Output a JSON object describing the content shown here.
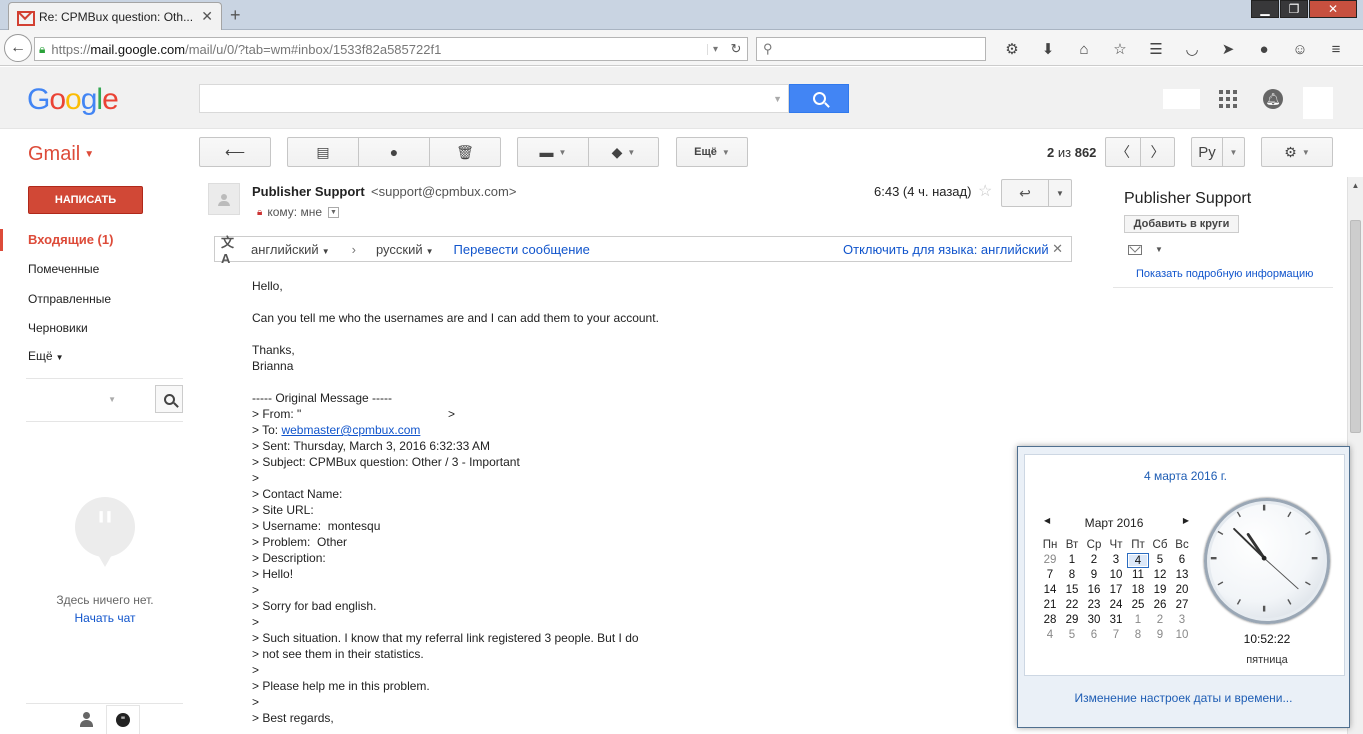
{
  "browser": {
    "tab_title": "Re: CPMBux question: Oth...",
    "tab_close": "✕",
    "new_tab": "+",
    "url_prefix": "https://",
    "url_domain": "mail.google.com",
    "url_path": "/mail/u/0/?tab=wm#inbox/1533f82a585722f1"
  },
  "gmail": {
    "label": "Gmail",
    "pager_range": "2",
    "pager_of": "из",
    "pager_total": "862",
    "more_label": "Ещё",
    "lang_btn": "Ру"
  },
  "nav": {
    "compose": "НАПИСАТЬ",
    "inbox": "Входящие (1)",
    "starred": "Помеченные",
    "sent": "Отправленные",
    "drafts": "Черновики",
    "more": "Ещё"
  },
  "hangouts": {
    "empty": "Здесь ничего нет.",
    "start_chat": "Начать чат"
  },
  "message": {
    "sender_name": "Publisher Support",
    "sender_email": "<support@cpmbux.com>",
    "to_line": "кому: мне",
    "time": "6:43 (4 ч. назад)"
  },
  "translate": {
    "from_lang": "английский",
    "to_lang": "русский",
    "translate_link": "Перевести сообщение",
    "disable_link": "Отключить для языка: английский"
  },
  "body": {
    "greeting": "Hello,",
    "question": "Can you tell me who the usernames are and I can add them to your account.",
    "thanks": "Thanks,",
    "signature": "Brianna",
    "orig_header": "----- Original Message -----",
    "from": "> From: \"                                            >",
    "to_prefix": "> To: ",
    "to_email": "webmaster@cpmbux.com",
    "sent": "> Sent: Thursday, March 3, 2016 6:32:33 AM",
    "subject": "> Subject: CPMBux question: Other / 3 - Important",
    "q1": ">",
    "contact": "> Contact Name:",
    "site": "> Site URL:",
    "username": "> Username:  montesqu",
    "problem": "> Problem:  Other",
    "description": "> Description:",
    "hello": "> Hello!",
    "q2": ">",
    "sorry": "> Sorry for bad english.",
    "q3": ">",
    "situation1": "> Such situation. I know that my referral link registered 3 people. But I do",
    "situation2": "> not see them in their statistics.",
    "q4": ">",
    "help": "> Please help me in this problem.",
    "q5": ">",
    "regards": "> Best regards,"
  },
  "contact_panel": {
    "name": "Publisher Support",
    "add_to_circles": "Добавить в круги",
    "details": "Показать подробную информацию"
  },
  "calendar": {
    "date_title": "4 марта 2016 г.",
    "month": "Март 2016",
    "weekdays": [
      "Пн",
      "Вт",
      "Ср",
      "Чт",
      "Пт",
      "Сб",
      "Вс"
    ],
    "days": [
      "29",
      "1",
      "2",
      "3",
      "4",
      "5",
      "6",
      "7",
      "8",
      "9",
      "10",
      "11",
      "12",
      "13",
      "14",
      "15",
      "16",
      "17",
      "18",
      "19",
      "20",
      "21",
      "22",
      "23",
      "24",
      "25",
      "26",
      "27",
      "28",
      "29",
      "30",
      "31",
      "1",
      "2",
      "3",
      "4",
      "5",
      "6",
      "7",
      "8",
      "9",
      "10"
    ],
    "today_index": 4,
    "clock_time": "10:52:22",
    "clock_day": "пятница",
    "footer": "Изменение настроек даты и времени..."
  },
  "colors": {
    "gmail_red": "#dd4b39",
    "link_blue": "#15c",
    "search_blue": "#4285f4"
  }
}
